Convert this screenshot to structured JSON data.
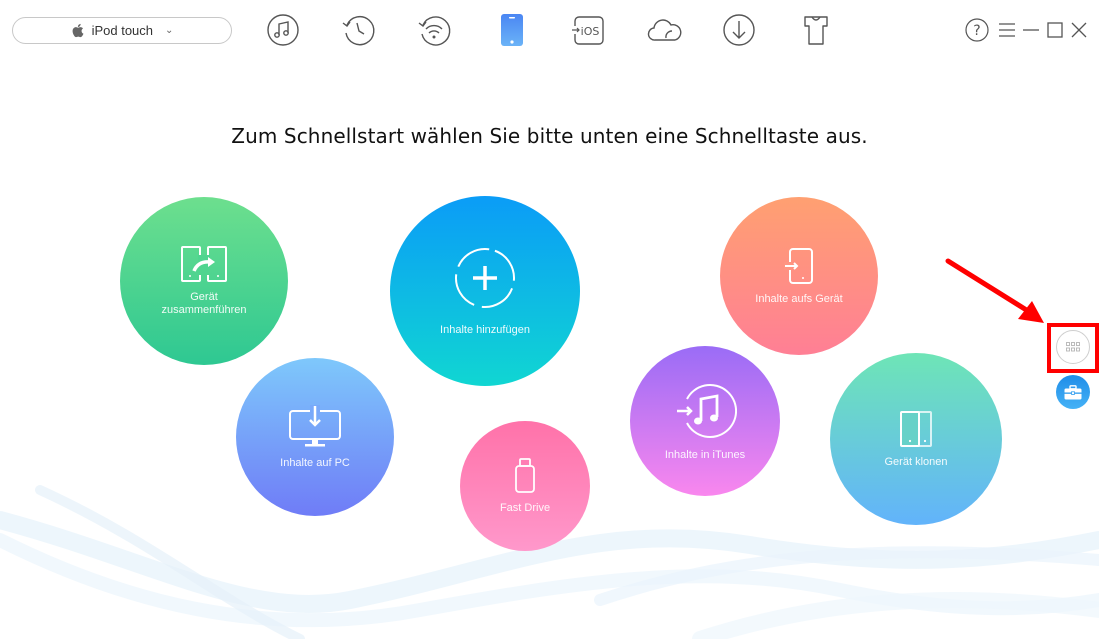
{
  "device_selector": {
    "label": "iPod touch",
    "icon": "apple-logo-icon",
    "dropdown_icon": "chevron-down-icon"
  },
  "toolbar": {
    "items": [
      {
        "name": "music",
        "icon": "music-note-circle-icon"
      },
      {
        "name": "history",
        "icon": "history-clock-icon"
      },
      {
        "name": "airbackup",
        "icon": "wifi-backup-icon"
      },
      {
        "name": "device",
        "icon": "phone-icon",
        "active": true
      },
      {
        "name": "ios-mover",
        "icon": "ios-transfer-icon",
        "text": "iOS"
      },
      {
        "name": "icloud",
        "icon": "cloud-icon"
      },
      {
        "name": "download",
        "icon": "download-circle-icon"
      },
      {
        "name": "toolkit",
        "icon": "tshirt-icon"
      }
    ],
    "active_color": "#4a90f5"
  },
  "window_controls": {
    "help": "help-icon",
    "menu": "menu-icon",
    "minimize": "minimize-icon",
    "maximize": "maximize-icon",
    "close": "close-icon"
  },
  "main": {
    "heading": "Zum Schnellstart wählen Sie bitte unten eine Schnelltaste aus.",
    "quick_actions": [
      {
        "id": "merge",
        "label_line1": "Gerät",
        "label_line2": "zusammenführen",
        "icon": "merge-devices-icon",
        "colors": [
          "#6ddf8e",
          "#2ec892"
        ]
      },
      {
        "id": "add",
        "label": "Inhalte hinzufügen",
        "icon": "add-content-icon",
        "colors": [
          "#0b9cf7",
          "#10d6d2"
        ]
      },
      {
        "id": "to-device",
        "label": "Inhalte aufs Gerät",
        "icon": "to-device-icon",
        "colors": [
          "#ffa071",
          "#ff7f95"
        ]
      },
      {
        "id": "to-pc",
        "label": "Inhalte auf PC",
        "icon": "monitor-download-icon",
        "colors": [
          "#7ec8fb",
          "#6f7cf7"
        ]
      },
      {
        "id": "fast-drive",
        "label": "Fast Drive",
        "icon": "usb-drive-icon",
        "colors": [
          "#ff72a9",
          "#ff98cb"
        ]
      },
      {
        "id": "to-itunes",
        "label": "Inhalte in iTunes",
        "icon": "itunes-transfer-icon",
        "colors": [
          "#9a6cf6",
          "#f987ee"
        ]
      },
      {
        "id": "clone",
        "label": "Gerät klonen",
        "icon": "clone-device-icon",
        "colors": [
          "#6ee5b6",
          "#62b3fb"
        ]
      }
    ]
  },
  "side_buttons": {
    "more": {
      "icon": "grid-apps-icon"
    },
    "toolbox": {
      "icon": "toolbox-icon",
      "color": "#2d9cef"
    }
  },
  "annotation": {
    "arrow_color": "#ff0000",
    "highlight_color": "#ff0000"
  }
}
